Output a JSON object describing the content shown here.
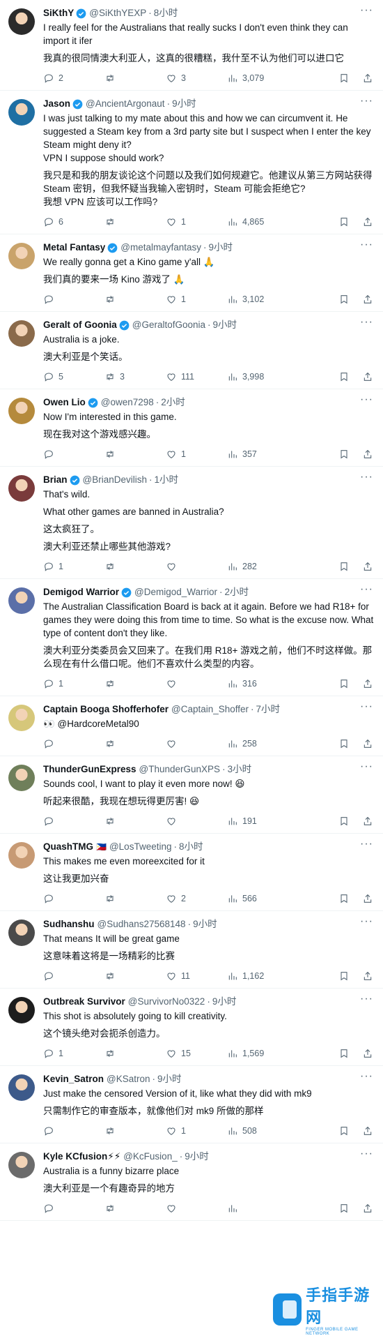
{
  "tweets": [
    {
      "name": "SiKthY",
      "verified": true,
      "flag": "",
      "handle": "@SiKthYEXP",
      "time": "8小时",
      "avatar_color": "#2b2b2b",
      "paragraphs": [
        "I really feel for the Australians that really sucks I don't even think they can import it ifer",
        "我真的很同情澳大利亚人，这真的很糟糕，我什至不认为他们可以进口它"
      ],
      "replies": "2",
      "retweets": "",
      "likes": "3",
      "views": "3,079"
    },
    {
      "name": "Jason",
      "verified": true,
      "flag": "",
      "handle": "@AncientArgonaut",
      "time": "9小时",
      "avatar_color": "#1f6fa3",
      "paragraphs": [
        "I was just talking to my mate about this and how we can circumvent it. He suggested a Steam key from a 3rd party site but I suspect when I enter the key Steam might deny it?\nVPN I suppose should work?",
        "我只是和我的朋友谈论这个问题以及我们如何规避它。他建议从第三方网站获得 Steam 密钥，但我怀疑当我输入密钥时，Steam 可能会拒绝它?\n我想 VPN 应该可以工作吗?"
      ],
      "replies": "6",
      "retweets": "",
      "likes": "1",
      "views": "4,865"
    },
    {
      "name": "Metal Fantasy",
      "verified": true,
      "flag": "",
      "handle": "@metalmayfantasy",
      "time": "9小时",
      "avatar_color": "#c9a36b",
      "paragraphs": [
        "We really gonna get a Kino game y'all 🙏",
        "我们真的要来一场 Kino 游戏了 🙏"
      ],
      "replies": "",
      "retweets": "",
      "likes": "1",
      "views": "3,102"
    },
    {
      "name": "Geralt of Goonia",
      "verified": true,
      "flag": "",
      "handle": "@GeraltofGoonia",
      "time": "9小时",
      "avatar_color": "#8a6a4a",
      "paragraphs": [
        "Australia is a joke.",
        "澳大利亚是个笑话。"
      ],
      "replies": "5",
      "retweets": "3",
      "likes": "111",
      "views": "3,998"
    },
    {
      "name": "Owen Lio",
      "verified": true,
      "flag": "",
      "handle": "@owen7298",
      "time": "2小时",
      "avatar_color": "#b58a3c",
      "paragraphs": [
        "Now I'm interested in this game.",
        "现在我对这个游戏感兴趣。"
      ],
      "replies": "",
      "retweets": "",
      "likes": "1",
      "views": "357"
    },
    {
      "name": "Brian",
      "verified": true,
      "flag": "",
      "handle": "@BrianDevilish",
      "time": "1小时",
      "avatar_color": "#7a3b3b",
      "paragraphs": [
        "That's wild.",
        "What other games are banned in Australia?",
        "这太疯狂了。",
        "澳大利亚还禁止哪些其他游戏?"
      ],
      "replies": "1",
      "retweets": "",
      "likes": "",
      "views": "282"
    },
    {
      "name": "Demigod Warrior",
      "verified": true,
      "flag": "",
      "handle": "@Demigod_Warrior",
      "time": "2小时",
      "avatar_color": "#5b6fa8",
      "paragraphs": [
        "The Australian Classification Board is back at it again. Before we had R18+ for games they were doing this from time to time. So what is the excuse now. What type of content don't they like.",
        "澳大利亚分类委员会又回来了。在我们用 R18+ 游戏之前，他们不时这样做。那么现在有什么借口呢。他们不喜欢什么类型的内容。"
      ],
      "replies": "1",
      "retweets": "",
      "likes": "",
      "views": "316"
    },
    {
      "name": "Captain Booga Shofferhofer",
      "verified": false,
      "flag": "",
      "handle": "@Captain_Shoffer",
      "time": "7小时",
      "avatar_color": "#d6c77a",
      "paragraphs": [
        "👀 @HardcoreMetal90"
      ],
      "replies": "",
      "retweets": "",
      "likes": "",
      "views": "258"
    },
    {
      "name": "ThunderGunExpress",
      "verified": false,
      "flag": "",
      "handle": "@ThunderGunXPS",
      "time": "3小时",
      "avatar_color": "#6f7f5a",
      "paragraphs": [
        "Sounds cool, I want to play it even more now! 😆",
        "听起来很酷，我现在想玩得更厉害! 😆"
      ],
      "replies": "",
      "retweets": "",
      "likes": "",
      "views": "191"
    },
    {
      "name": "QuashTMG",
      "verified": false,
      "flag": "🇵🇭",
      "handle": "@LosTweeting",
      "time": "8小时",
      "avatar_color": "#c79a74",
      "paragraphs": [
        "This makes me even moreexcited for it",
        "这让我更加兴奋"
      ],
      "replies": "",
      "retweets": "",
      "likes": "2",
      "views": "566"
    },
    {
      "name": "Sudhanshu",
      "verified": false,
      "flag": "",
      "handle": "@Sudhans27568148",
      "time": "9小时",
      "avatar_color": "#4a4a4a",
      "paragraphs": [
        "That means It will be great game",
        "这意味着这将是一场精彩的比赛"
      ],
      "replies": "",
      "retweets": "",
      "likes": "11",
      "views": "1,162"
    },
    {
      "name": "Outbreak Survivor",
      "verified": false,
      "flag": "",
      "handle": "@SurvivorNo0322",
      "time": "9小时",
      "avatar_color": "#1d1d1d",
      "paragraphs": [
        "This shot is absolutely going to kill creativity.",
        "这个镜头绝对会扼杀创造力。"
      ],
      "replies": "1",
      "retweets": "",
      "likes": "15",
      "views": "1,569"
    },
    {
      "name": "Kevin_Satron",
      "verified": false,
      "flag": "",
      "handle": "@KSatron",
      "time": "9小时",
      "avatar_color": "#3d5a8a",
      "paragraphs": [
        "Just make the censored Version of it, like what they did with mk9",
        "只需制作它的审查版本，就像他们对 mk9 所做的那样"
      ],
      "replies": "",
      "retweets": "",
      "likes": "1",
      "views": "508"
    },
    {
      "name": "Kyle KCfusion⚡⚡",
      "verified": false,
      "flag": "",
      "handle": "@KcFusion_",
      "time": "9小时",
      "avatar_color": "#6b6b6b",
      "paragraphs": [
        "Australia is a funny bizarre place",
        "澳大利亚是一个有趣奇异的地方"
      ],
      "replies": "",
      "retweets": "",
      "likes": "",
      "views": ""
    }
  ],
  "watermark": {
    "cn": "手指手游网",
    "en": "FINGER MOBILE GAME NETWORK"
  },
  "colors": {
    "verified": "#1d9bf0",
    "muted": "#536471",
    "text": "#0f1419",
    "watermark": "#1a8fe0"
  },
  "icons": [
    "reply-icon",
    "retweet-icon",
    "like-icon",
    "views-icon",
    "bookmark-icon",
    "share-icon",
    "more-icon",
    "verified-badge-icon"
  ]
}
